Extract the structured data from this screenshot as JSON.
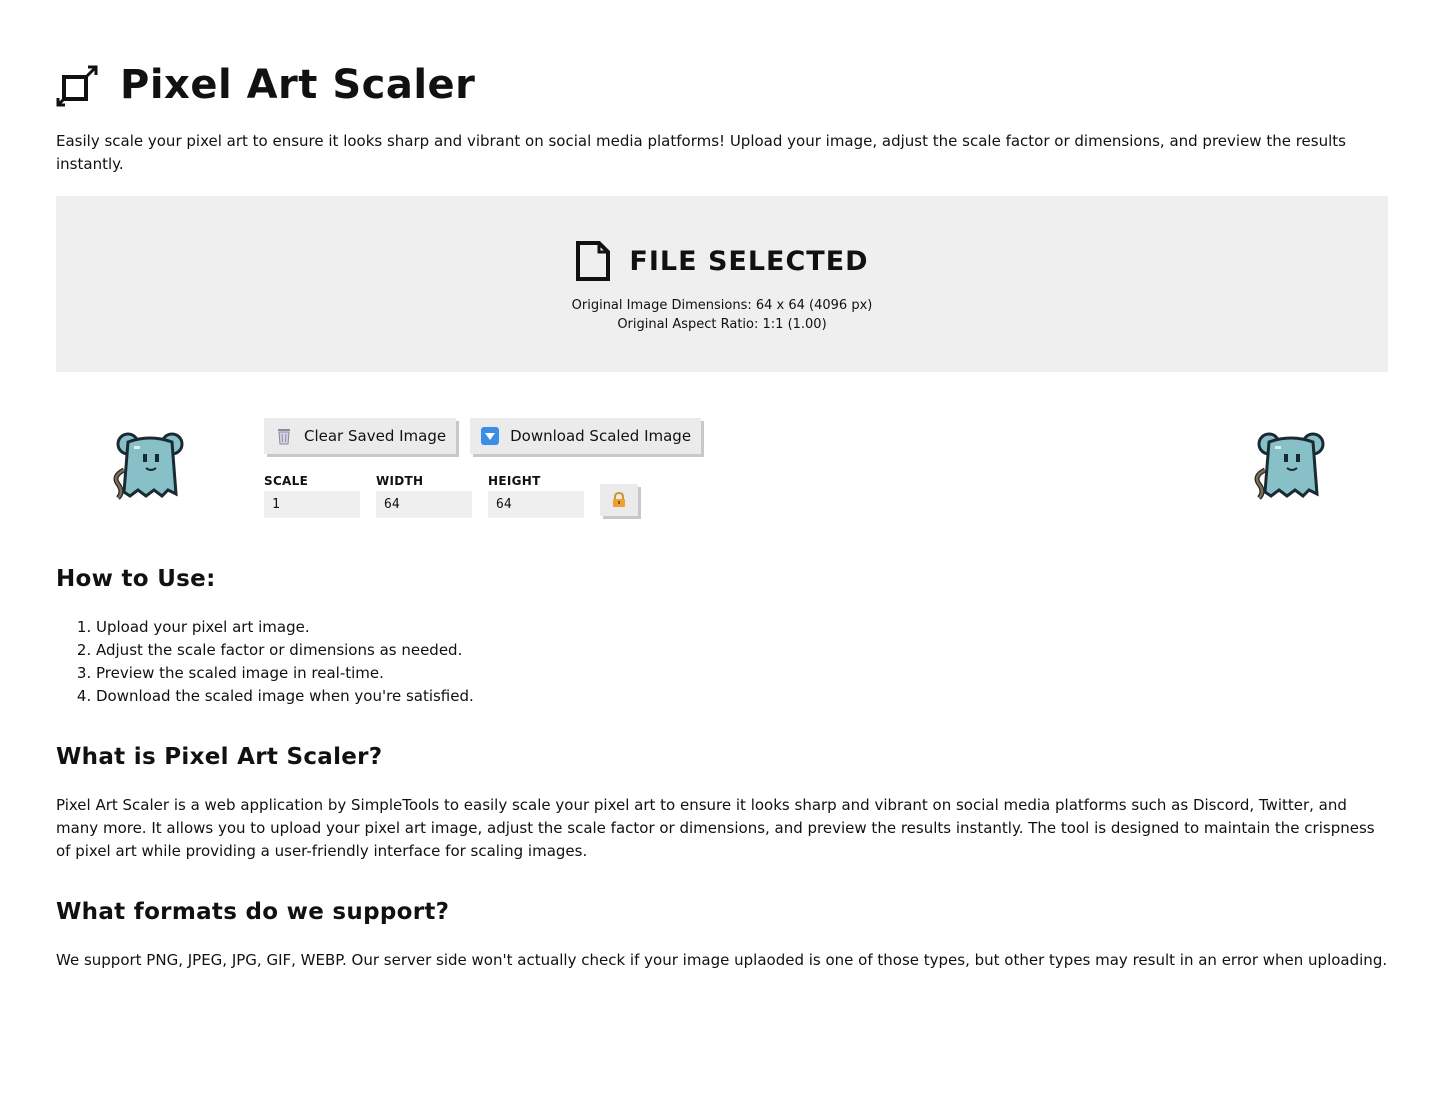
{
  "header": {
    "title": "Pixel Art Scaler",
    "intro": "Easily scale your pixel art to ensure it looks sharp and vibrant on social media platforms! Upload your image, adjust the scale factor or dimensions, and preview the results instantly."
  },
  "dropzone": {
    "status": "FILE SELECTED",
    "dimensions": "Original Image Dimensions: 64 x 64 (4096 px)",
    "aspect": "Original Aspect Ratio: 1:1 (1.00)"
  },
  "controls": {
    "clear_label": "Clear Saved Image",
    "download_label": "Download Scaled Image",
    "scale_label": "SCALE",
    "scale_value": "1",
    "width_label": "WIDTH",
    "width_value": "64",
    "height_label": "HEIGHT",
    "height_value": "64",
    "lock_icon": "lock-icon",
    "preview_icon": "mouse-ghost-sprite"
  },
  "how_to": {
    "heading": "How to Use:",
    "steps": [
      "Upload your pixel art image.",
      "Adjust the scale factor or dimensions as needed.",
      "Preview the scaled image in real-time.",
      "Download the scaled image when you're satisfied."
    ]
  },
  "what_is": {
    "heading": "What is Pixel Art Scaler?",
    "body": "Pixel Art Scaler is a web application by SimpleTools to easily scale your pixel art to ensure it looks sharp and vibrant on social media platforms such as Discord, Twitter, and many more. It allows you to upload your pixel art image, adjust the scale factor or dimensions, and preview the results instantly. The tool is designed to maintain the crispness of pixel art while providing a user-friendly interface for scaling images."
  },
  "formats": {
    "heading": "What formats do we support?",
    "body": "We support PNG, JPEG, JPG, GIF, WEBP. Our server side won't actually check if your image uplaoded is one of those types, but other types may result in an error when uploading."
  },
  "colors": {
    "page_bg": "#ffffff",
    "panel_bg": "#efefef",
    "sprite_body": "#88c0c8",
    "sprite_outline": "#1a2a33",
    "lock_color": "#f0a030",
    "download_icon": "#3a8ee6"
  }
}
